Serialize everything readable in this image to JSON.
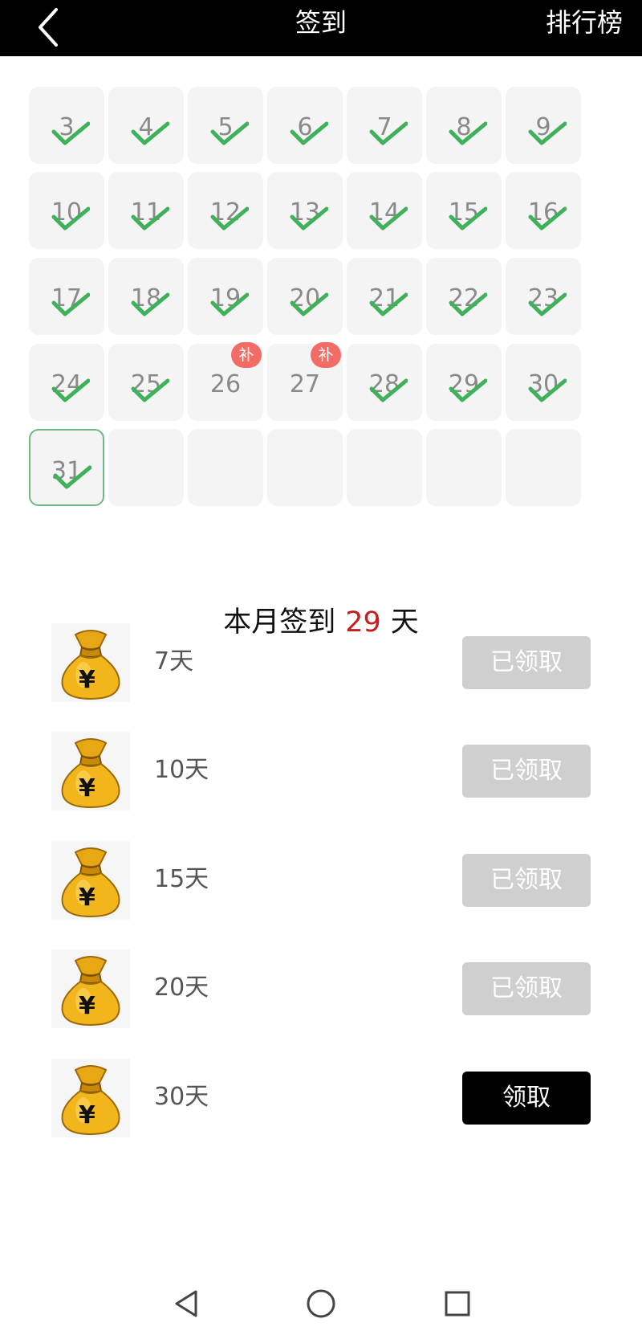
{
  "header": {
    "title": "签到",
    "rank_label": "排行榜"
  },
  "calendar": {
    "top_row_checked": [
      false,
      false,
      false,
      false,
      false,
      true,
      true
    ],
    "days": [
      {
        "day": "3",
        "checked": true
      },
      {
        "day": "4",
        "checked": true
      },
      {
        "day": "5",
        "checked": true
      },
      {
        "day": "6",
        "checked": true
      },
      {
        "day": "7",
        "checked": true
      },
      {
        "day": "8",
        "checked": true
      },
      {
        "day": "9",
        "checked": true
      },
      {
        "day": "10",
        "checked": true
      },
      {
        "day": "11",
        "checked": true
      },
      {
        "day": "12",
        "checked": true
      },
      {
        "day": "13",
        "checked": true
      },
      {
        "day": "14",
        "checked": true
      },
      {
        "day": "15",
        "checked": true
      },
      {
        "day": "16",
        "checked": true
      },
      {
        "day": "17",
        "checked": true
      },
      {
        "day": "18",
        "checked": true
      },
      {
        "day": "19",
        "checked": true
      },
      {
        "day": "20",
        "checked": true
      },
      {
        "day": "21",
        "checked": true
      },
      {
        "day": "22",
        "checked": true
      },
      {
        "day": "23",
        "checked": true
      },
      {
        "day": "24",
        "checked": true
      },
      {
        "day": "25",
        "checked": true
      },
      {
        "day": "26",
        "checked": false,
        "badge": "补"
      },
      {
        "day": "27",
        "checked": false,
        "badge": "补"
      },
      {
        "day": "28",
        "checked": true
      },
      {
        "day": "29",
        "checked": true
      },
      {
        "day": "30",
        "checked": true
      },
      {
        "day": "31",
        "checked": true,
        "today": true
      },
      {
        "day": ""
      },
      {
        "day": ""
      },
      {
        "day": ""
      },
      {
        "day": ""
      },
      {
        "day": ""
      },
      {
        "day": ""
      }
    ]
  },
  "summary": {
    "prefix": "本月签到",
    "count": "29",
    "suffix": "天"
  },
  "rewards": [
    {
      "label": "7天",
      "button": "已领取",
      "claimed": true
    },
    {
      "label": "10天",
      "button": "已领取",
      "claimed": true
    },
    {
      "label": "15天",
      "button": "已领取",
      "claimed": true
    },
    {
      "label": "20天",
      "button": "已领取",
      "claimed": true
    },
    {
      "label": "30天",
      "button": "领取",
      "claimed": false
    }
  ],
  "colors": {
    "check": "#3fb15a",
    "badge": "#f26b64",
    "count": "#c81d1d",
    "claimed_button": "#cfcfcf",
    "active_button": "#000000"
  },
  "icons": {
    "back": "chevron-left-icon",
    "reward": "money-bag-icon",
    "nav_back": "triangle-back-icon",
    "nav_home": "circle-home-icon",
    "nav_recent": "square-recent-icon"
  }
}
